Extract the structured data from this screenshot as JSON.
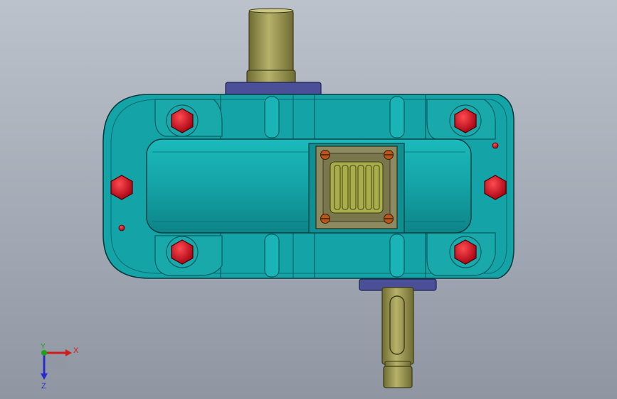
{
  "viewport": {
    "background_top": "#bcc2cb",
    "background_bottom": "#8f96a2"
  },
  "model": {
    "housing_color": "#14a3a6",
    "housing_dark": "#0a6e72",
    "shaft_color": "#9f9b52",
    "seal_cap_color": "#4b4f97",
    "bolt_color": "#d90d1e",
    "window_color": "#8e8a60",
    "window_glass": "#a9ad4c"
  },
  "triad": {
    "x_label": "X",
    "y_label": "Y",
    "z_label": "Z",
    "x_color": "#d11c1c",
    "y_color": "#1aa31a",
    "z_color": "#2a2ad1"
  }
}
